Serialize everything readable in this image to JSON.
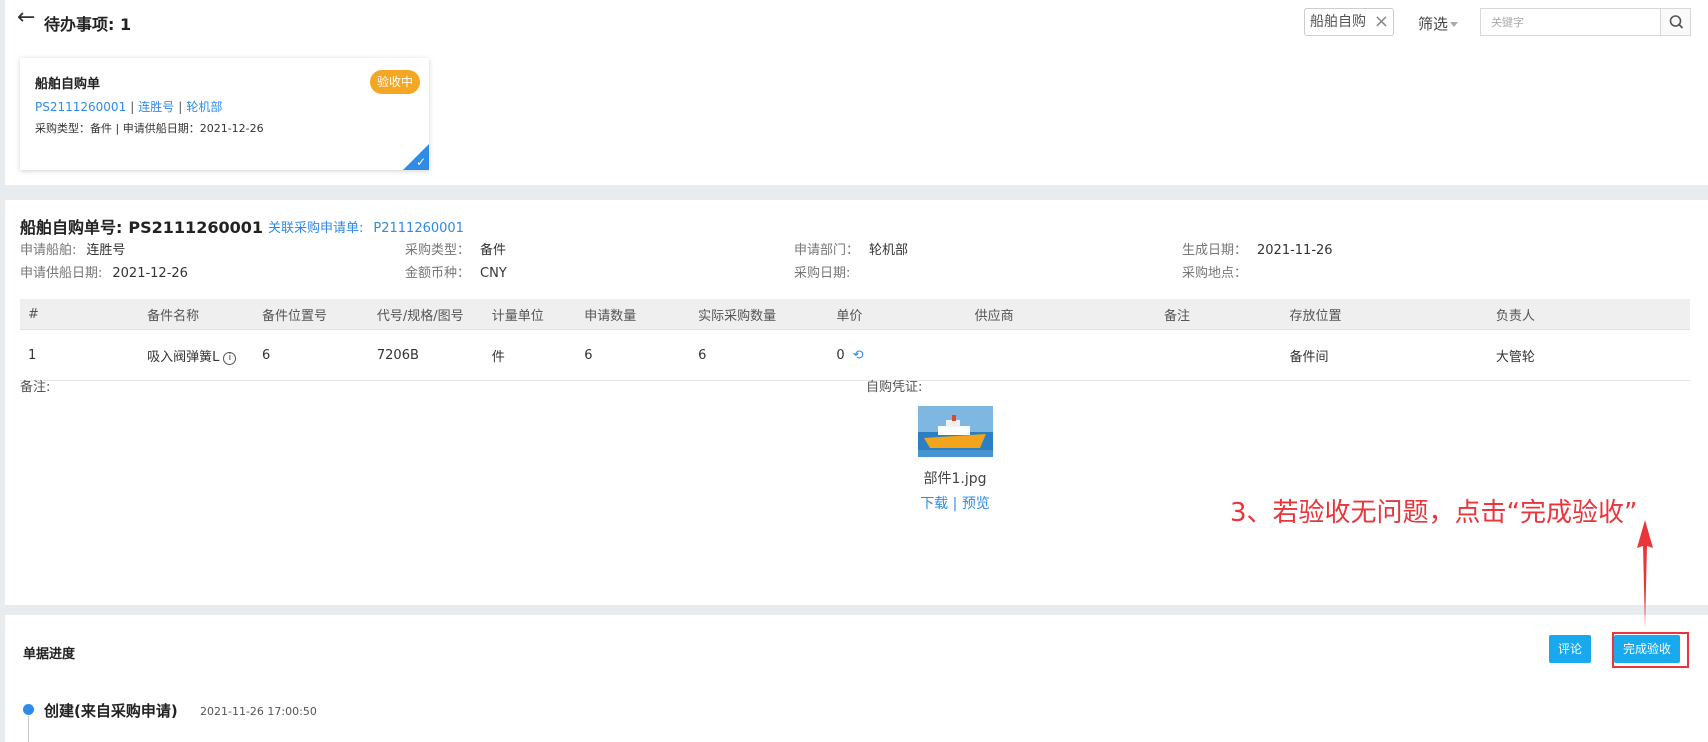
{
  "header": {
    "title": "待办事项: 1",
    "filter_tag": "船舶自购",
    "filter_label": "筛选",
    "search_placeholder": "关键字"
  },
  "card": {
    "title": "船舶自购单",
    "status": "验收中",
    "order_no": "PS2111260001",
    "ship": "连胜号",
    "department": "轮机部",
    "meta": "采购类型：备件 | 申请供船日期：2021-12-26"
  },
  "detail": {
    "title_label": "船舶自购单号:",
    "order_no": "PS2111260001",
    "related_label": "关联采购申请单:",
    "related_no": "P2111260001",
    "fields": [
      {
        "label": "申请船舶:",
        "value": "连胜号"
      },
      {
        "label": "采购类型：",
        "value": "备件"
      },
      {
        "label": "申请部门：",
        "value": "轮机部"
      },
      {
        "label": "生成日期：",
        "value": "2021-11-26"
      },
      {
        "label": "申请供船日期:",
        "value": "2021-12-26"
      },
      {
        "label": "金额币种：",
        "value": "CNY"
      },
      {
        "label": "采购日期:",
        "value": ""
      },
      {
        "label": "采购地点：",
        "value": ""
      }
    ],
    "table": {
      "columns": [
        "#",
        "备件名称",
        "备件位置号",
        "代号/规格/图号",
        "计量单位",
        "申请数量",
        "实际采购数量",
        "单价",
        "供应商",
        "备注",
        "存放位置",
        "负责人"
      ],
      "rows": [
        [
          "1",
          "吸入阀弹簧L",
          "6",
          "7206B",
          "件",
          "6",
          "6",
          "0",
          "",
          "",
          "备件间",
          "大管轮"
        ]
      ]
    },
    "remark_label": "备注:",
    "voucher_label": "自购凭证:",
    "voucher_file": "部件1.jpg",
    "voucher_download": "下载",
    "voucher_sep": "|",
    "voucher_preview": "预览"
  },
  "annotation": "3、若验收无问题，点击“完成验收”",
  "progress": {
    "title": "单据进度",
    "comment_button": "评论",
    "complete_button": "完成验收",
    "timeline": [
      {
        "title": "创建(来自采购申请)",
        "time": "2021-11-26 17:00:50"
      }
    ]
  },
  "colors": {
    "accent": "#2e8be6",
    "button": "#18a9ef",
    "badge": "#f5a623",
    "annotation": "#e8363b"
  }
}
